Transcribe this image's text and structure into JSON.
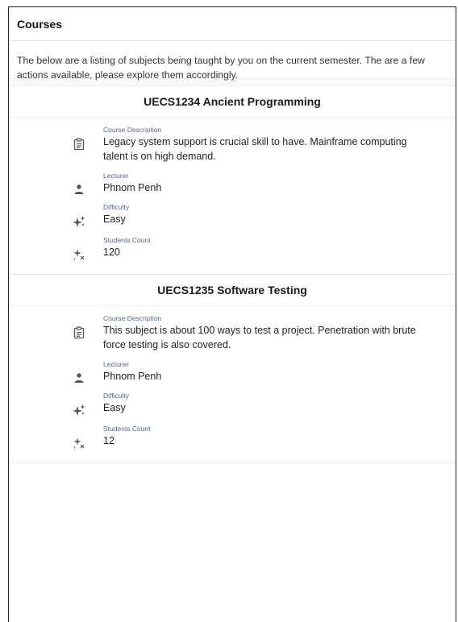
{
  "page": {
    "title": "Courses",
    "intro": "The below are a listing of subjects being taught by you on the current semester. The are a few actions available, please explore them accordingly."
  },
  "courses": [
    {
      "title": "UECS1234 Ancient Programming",
      "fields": [
        {
          "label": "Course Description",
          "value": "Legacy system support is crucial skill to have. Mainframe computing talent is on high demand.",
          "icon": "clipboard-icon"
        },
        {
          "label": "Lecturer",
          "value": "Phnom Penh",
          "icon": "person-icon"
        },
        {
          "label": "Difficulty",
          "value": "Easy",
          "icon": "sparkle-icon"
        },
        {
          "label": "Students Count",
          "value": "120",
          "icon": "sparkle-x-icon"
        }
      ]
    },
    {
      "title": "UECS1235 Software Testing",
      "fields": [
        {
          "label": "Course Description",
          "value": "This subject is about 100 ways to test a project. Penetration with brute force testing is also covered.",
          "icon": "clipboard-icon"
        },
        {
          "label": "Lecturer",
          "value": "Phnom Penh",
          "icon": "person-icon"
        },
        {
          "label": "Difficulty",
          "value": "Easy",
          "icon": "sparkle-icon"
        },
        {
          "label": "Students Count",
          "value": "12",
          "icon": "sparkle-x-icon"
        }
      ]
    }
  ]
}
